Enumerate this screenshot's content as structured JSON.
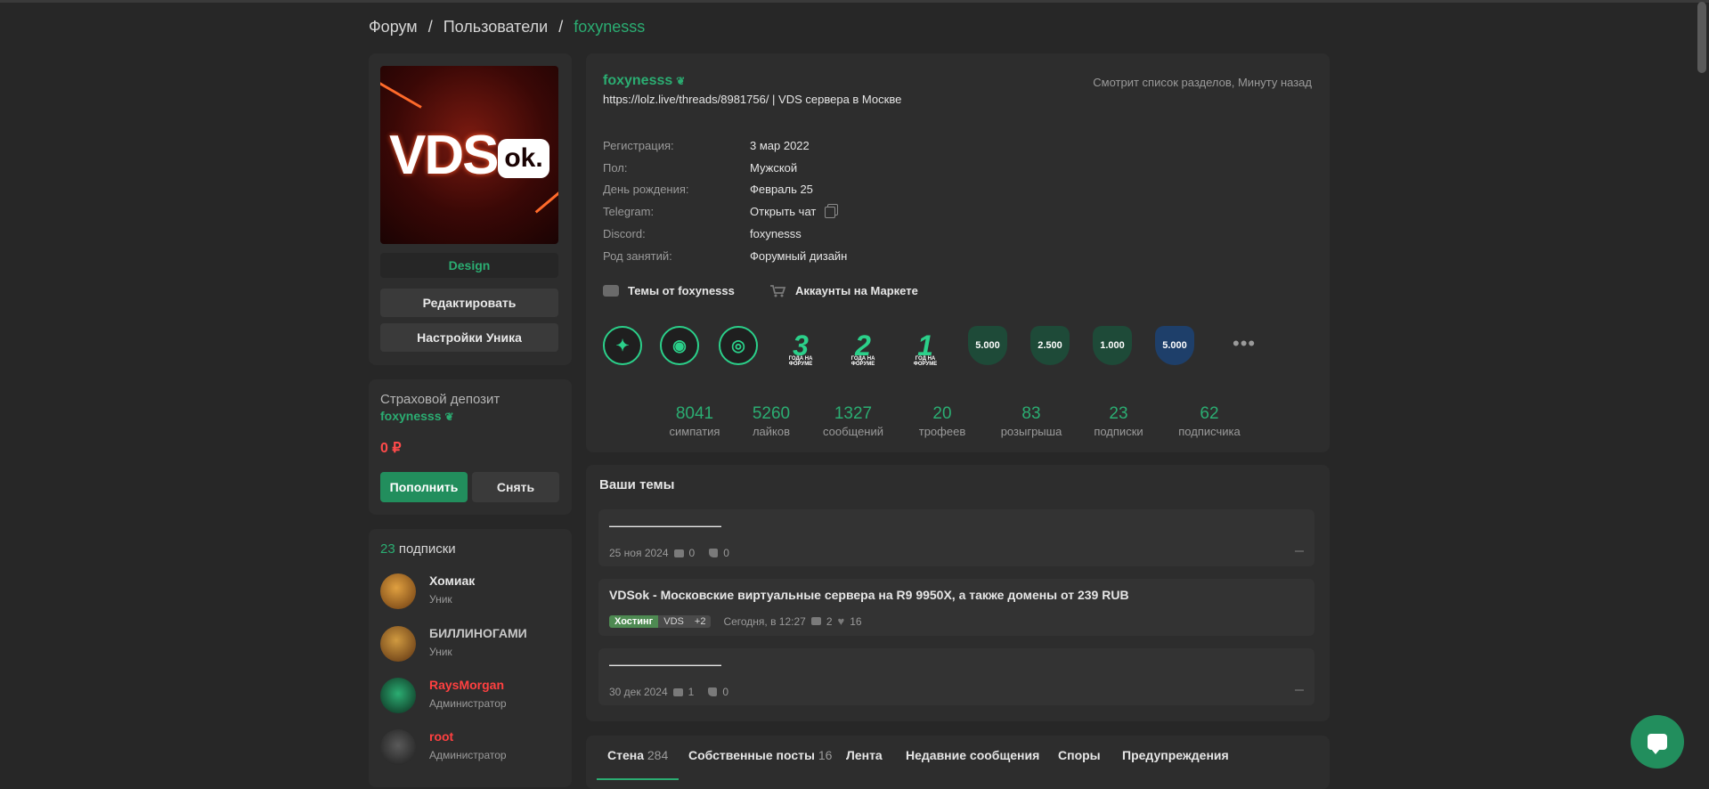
{
  "breadcrumb": {
    "forum": "Форум",
    "users": "Пользователи",
    "current": "foxynesss",
    "sep": "/"
  },
  "profile_card": {
    "avatar_text": "VDS",
    "avatar_badge": "ok.",
    "title": "Design",
    "edit_label": "Редактировать",
    "settings_label": "Настройки Уника"
  },
  "deposit": {
    "title": "Страховой депозит",
    "user": "foxynesss",
    "amount": "0 ₽",
    "topup_label": "Пополнить",
    "withdraw_label": "Снять"
  },
  "subscriptions": {
    "count": "23",
    "label": "подписки",
    "items": [
      {
        "name": "Хомиак",
        "role": "Уник",
        "name_color": "#e6e6e6"
      },
      {
        "name": "БИЛЛИНОГАМИ",
        "role": "Уник",
        "name_color": "#c8c8c8"
      },
      {
        "name": "RaysMorgan",
        "role": "Администратор",
        "name_color": "#ff4040"
      },
      {
        "name": "root",
        "role": "Администратор",
        "name_color": "#ff4040"
      }
    ]
  },
  "profile": {
    "username": "foxynesss",
    "status": "https://lolz.live/threads/8981756/ | VDS сервера в Москве",
    "activity": "Смотрит список разделов, Минуту назад",
    "info": [
      {
        "label": "Регистрация:",
        "value": "3 мар 2022"
      },
      {
        "label": "Пол:",
        "value": "Мужской"
      },
      {
        "label": "День рождения:",
        "value": "Февраль 25"
      },
      {
        "label": "Telegram:",
        "value": "Открыть чат"
      },
      {
        "label": "Discord:",
        "value": "foxynesss"
      },
      {
        "label": "Род занятий:",
        "value": "Форумный дизайн"
      }
    ],
    "links": {
      "topics": "Темы от foxynesss",
      "market": "Аккаунты на Маркете"
    },
    "trophies": [
      {
        "label": "",
        "kind": "ring"
      },
      {
        "label": "",
        "kind": "ring"
      },
      {
        "label": "",
        "kind": "ring"
      },
      {
        "label": "3",
        "sub": "ГОДА НА ФОРУМЕ",
        "kind": "big"
      },
      {
        "label": "2",
        "sub": "ГОДА НА ФОРУМЕ",
        "kind": "big"
      },
      {
        "label": "1",
        "sub": "ГОД НА ФОРУМЕ",
        "kind": "big"
      },
      {
        "label": "5.000",
        "kind": "heart"
      },
      {
        "label": "2.500",
        "kind": "heart"
      },
      {
        "label": "1.000",
        "kind": "heart"
      },
      {
        "label": "5.000",
        "kind": "blue"
      }
    ],
    "more": "•••",
    "stats": [
      {
        "num": "8041",
        "label": "симпатия"
      },
      {
        "num": "5260",
        "label": "лайков"
      },
      {
        "num": "1327",
        "label": "сообщений"
      },
      {
        "num": "20",
        "label": "трофеев"
      },
      {
        "num": "83",
        "label": "розыгрыша"
      },
      {
        "num": "23",
        "label": "подписки"
      },
      {
        "num": "62",
        "label": "подписчика"
      }
    ]
  },
  "topics": {
    "title": "Ваши темы",
    "items": [
      {
        "title": "—————————",
        "date": "25 ноя 2024",
        "replies": "0",
        "likes": "0"
      },
      {
        "title": "VDSok - Московские виртуальные сервера на R9 9950X, а также домены от 239 RUB",
        "tag1": "Хостинг",
        "tag2": "VDS",
        "tag3": "+2",
        "date": "Сегодня, в 12:27",
        "replies": "2",
        "likes": "16"
      },
      {
        "title": "—————————",
        "date": "30 дек 2024",
        "replies": "1",
        "likes": "0"
      }
    ]
  },
  "tabs": [
    {
      "label": "Стена",
      "count": "284"
    },
    {
      "label": "Собственные посты",
      "count": "16"
    },
    {
      "label": "Лента",
      "count": ""
    },
    {
      "label": "Недавние сообщения",
      "count": ""
    },
    {
      "label": "Споры",
      "count": ""
    },
    {
      "label": "Предупреждения",
      "count": ""
    }
  ],
  "colors": {
    "accent": "#2bad72",
    "admin": "#ff4040",
    "background": "#272727",
    "panel": "#2d2d2d"
  }
}
